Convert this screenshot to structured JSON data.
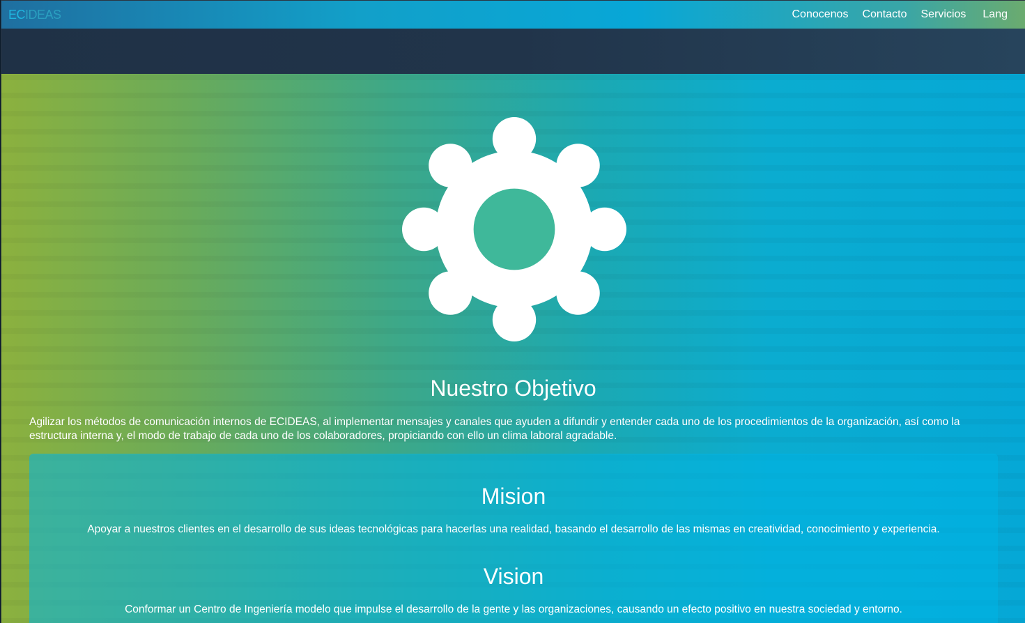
{
  "header": {
    "brand_prefix": "EC",
    "brand_suffix": "IDEAS",
    "nav": [
      {
        "label": "Conocenos"
      },
      {
        "label": "Contacto"
      },
      {
        "label": "Servicios"
      },
      {
        "label": "Lang"
      }
    ]
  },
  "hero": {
    "icon": "gear-icon",
    "title": "Nuestro Objetivo",
    "objective": "Agilizar los métodos de comunicación internos de ECIDEAS, al implementar mensajes y canales que ayuden a difundir y entender cada uno de los procedimientos de la organización, así como la estructura interna y, el modo de trabajo de cada uno de los colaboradores, propiciando con ello un clima laboral agradable."
  },
  "card": {
    "mision_title": "Mision",
    "mision_text": "Apoyar a nuestros clientes en el desarrollo de sus ideas tecnológicas para hacerlas una realidad, basando el desarrollo de las mismas en creatividad, conocimiento y experiencia.",
    "vision_title": "Vision",
    "vision_text": "Conformar un Centro de Ingeniería modelo que impulse el desarrollo de la gente y las organizaciones, causando un efecto positivo en nuestra sociedad y entorno."
  },
  "colors": {
    "gradient_left": "#8cb13e",
    "gradient_right": "#05a8d6",
    "dark_band": "#21344a",
    "gear": "#ffffff",
    "gear_hole": "#3fb89a"
  }
}
